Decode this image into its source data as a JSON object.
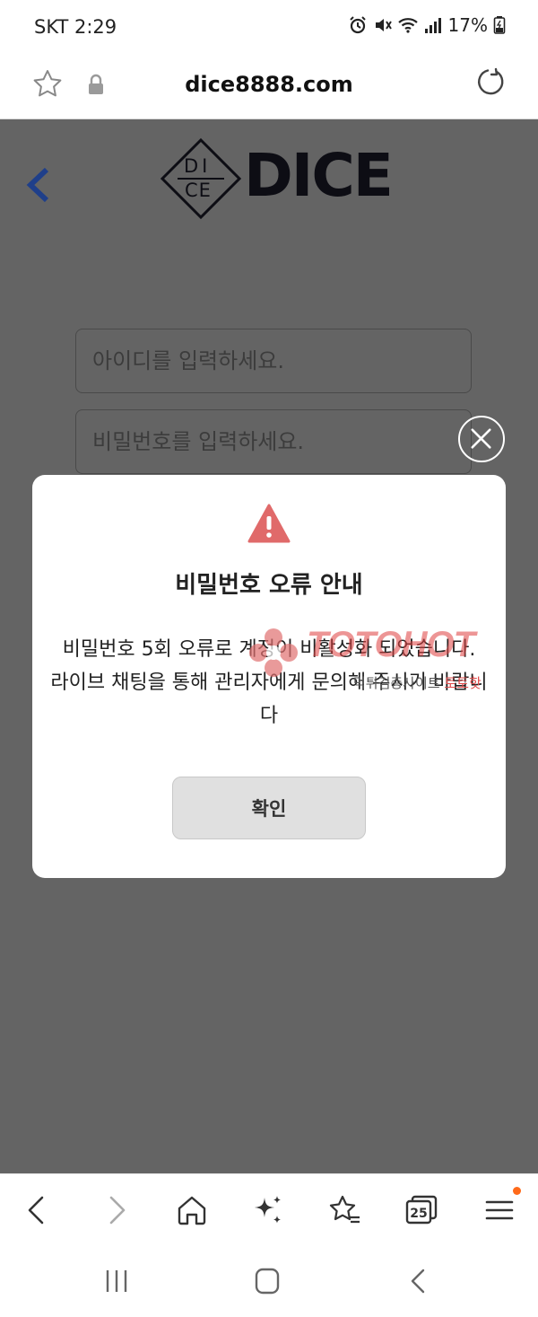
{
  "status_bar": {
    "time": "SKT 2:29",
    "battery": "17%",
    "icons": [
      "alarm-icon",
      "mute-icon",
      "wifi-icon",
      "signal-icon",
      "battery-icon"
    ]
  },
  "address_bar": {
    "url": "dice8888.com",
    "icons": [
      "star-icon",
      "lock-icon",
      "reload-icon"
    ]
  },
  "page": {
    "logo_mark_text_top": "DI",
    "logo_mark_text_bottom": "CE",
    "logo_word": "DICE",
    "username_placeholder": "아이디를 입력하세요.",
    "password_placeholder": "비밀번호를 입력하세요."
  },
  "dialog": {
    "title": "비밀번호 오류 안내",
    "message_line1": "비밀번호 5회 오류로 계정이 비활성화 되었습니다.",
    "message_line2": "라이브 채팅을 통해 관리자에게 문의해 주시기 바랍니다",
    "confirm_label": "확인",
    "warning_color": "#e06a6a"
  },
  "watermark": {
    "brand": "TOTOHOT",
    "subtitle_prefix": "먹튀검증사이트 ",
    "subtitle_highlight": "토토핫"
  },
  "browser_toolbar": {
    "tab_count": "25",
    "notification_dot_color": "#ff6a1a"
  },
  "colors": {
    "overlay": "#646464",
    "back_arrow": "#1f3f8a",
    "logo": "#0d0d14"
  }
}
